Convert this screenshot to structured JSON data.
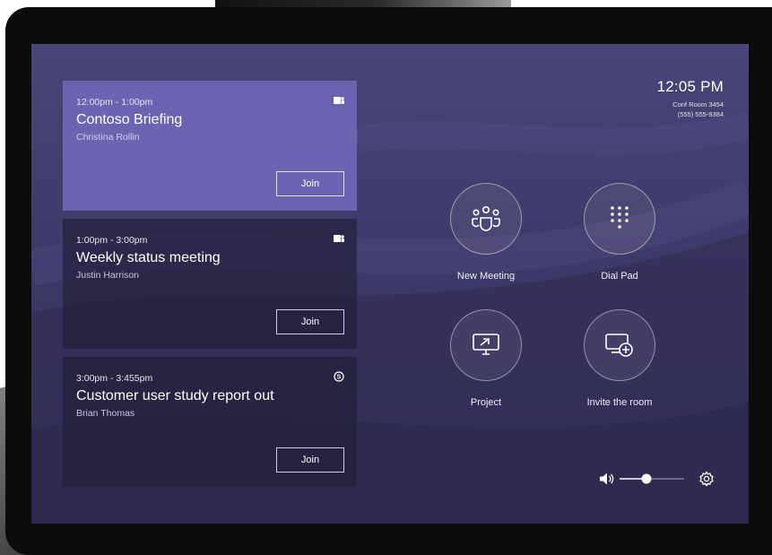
{
  "status": {
    "time": "12:05 PM",
    "room": "Conf Room 3454",
    "phone": "(555) 555-9384"
  },
  "meetings": [
    {
      "time": "12:00pm - 1:00pm",
      "title": "Contoso Briefing",
      "host": "Christina Rollin",
      "service_icon": "teams-icon",
      "join_label": "Join",
      "active": true
    },
    {
      "time": "1:00pm - 3:00pm",
      "title": "Weekly status meeting",
      "host": "Justin Harrison",
      "service_icon": "teams-icon",
      "join_label": "Join",
      "active": false
    },
    {
      "time": "3:00pm - 3:455pm",
      "title": "Customer user study report out",
      "host": "Brian Thomas",
      "service_icon": "skype-icon",
      "join_label": "Join",
      "active": false
    }
  ],
  "actions": {
    "new_meeting": {
      "label": "New Meeting",
      "icon": "people-group-icon"
    },
    "dial_pad": {
      "label": "Dial Pad",
      "icon": "dialpad-icon"
    },
    "project": {
      "label": "Project",
      "icon": "projector-screen-icon"
    },
    "invite": {
      "label": "Invite the room",
      "icon": "invite-room-icon"
    }
  },
  "footer": {
    "volume_icon": "speaker-icon",
    "volume_level": 0.5,
    "settings_icon": "gear-icon"
  },
  "colors": {
    "screen_bg": "#3d3968",
    "active_card": "#6b64b0",
    "card_bg": "#23203a"
  }
}
